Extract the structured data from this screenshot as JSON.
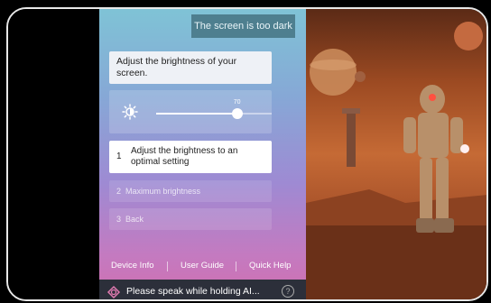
{
  "assistant": {
    "user_query": "The screen is too dark",
    "prompt": "Adjust the brightness of your screen.",
    "slider": {
      "value": 70,
      "value_label": "70",
      "icon": "brightness-icon"
    },
    "options": [
      {
        "number": "1",
        "label": "Adjust the brightness to an optimal setting"
      },
      {
        "number": "2",
        "label": "Maximum brightness"
      },
      {
        "number": "3",
        "label": "Back"
      }
    ]
  },
  "footer": {
    "device_info": "Device Info",
    "user_guide": "User Guide",
    "quick_help": "Quick Help"
  },
  "voice": {
    "prompt": "Please speak while holding AI...",
    "icon": "voice-assistant-icon",
    "help_icon": "help-icon",
    "help_symbol": "?"
  }
}
